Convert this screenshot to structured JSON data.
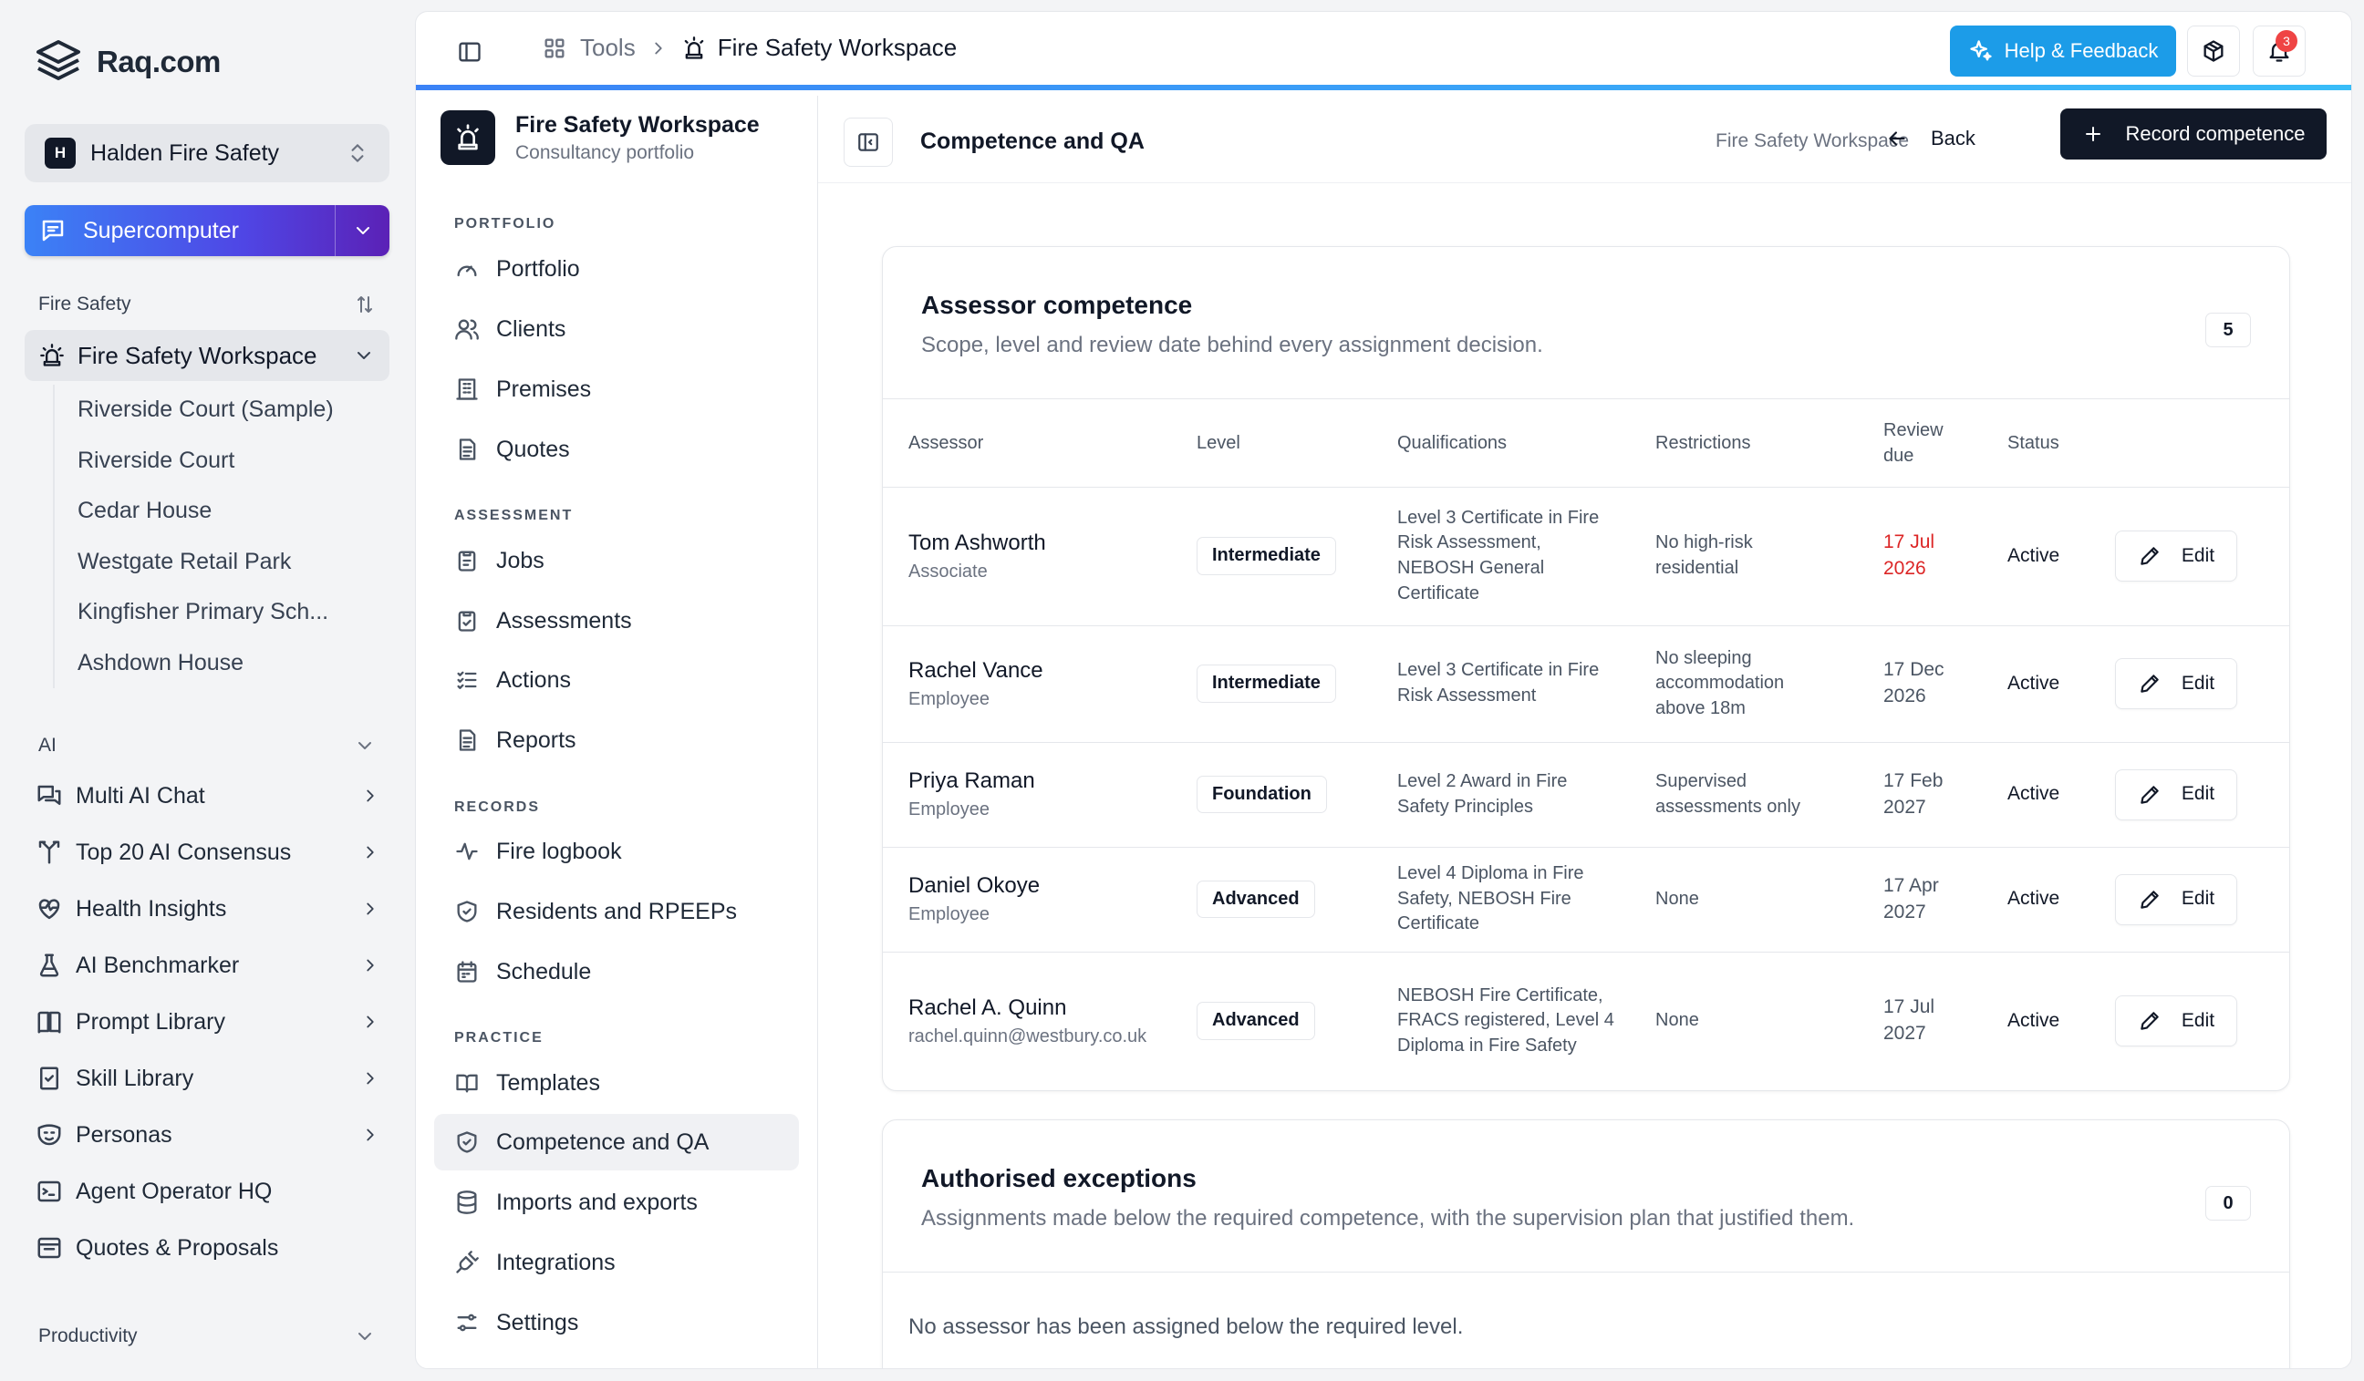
{
  "brand": {
    "name": "Raq.com"
  },
  "org": {
    "badge": "H",
    "name": "Halden Fire Safety"
  },
  "supercomputer": {
    "label": "Supercomputer"
  },
  "sidebar": {
    "fire_section": "Fire Safety",
    "workspace": "Fire Safety Workspace",
    "workspace_items": [
      "Riverside Court (Sample)",
      "Riverside Court",
      "Cedar House",
      "Westgate Retail Park",
      "Kingfisher Primary Sch...",
      "Ashdown House"
    ],
    "ai_section": "AI",
    "ai_items": [
      {
        "label": "Multi AI Chat",
        "icon": "chat-icon",
        "chevron": true
      },
      {
        "label": "Top 20 AI Consensus",
        "icon": "merge-icon",
        "chevron": true
      },
      {
        "label": "Health Insights",
        "icon": "heart-pulse-icon",
        "chevron": true
      },
      {
        "label": "AI Benchmarker",
        "icon": "flask-icon",
        "chevron": true
      },
      {
        "label": "Prompt Library",
        "icon": "book-icon",
        "chevron": true
      },
      {
        "label": "Skill Library",
        "icon": "skill-book-icon",
        "chevron": true
      },
      {
        "label": "Personas",
        "icon": "mask-icon",
        "chevron": true
      },
      {
        "label": "Agent Operator HQ",
        "icon": "terminal-icon",
        "chevron": false
      },
      {
        "label": "Quotes & Proposals",
        "icon": "inbox-icon",
        "chevron": false
      }
    ],
    "productivity_section": "Productivity"
  },
  "topbar": {
    "breadcrumb_tools": "Tools",
    "breadcrumb_current": "Fire Safety Workspace",
    "help_label": "Help & Feedback",
    "notification_count": "3"
  },
  "wsnav": {
    "title": "Fire Safety Workspace",
    "subtitle": "Consultancy portfolio",
    "groups": {
      "portfolio": "PORTFOLIO",
      "assessment": "ASSESSMENT",
      "records": "RECORDS",
      "practice": "PRACTICE"
    },
    "items": {
      "portfolio": "Portfolio",
      "clients": "Clients",
      "premises": "Premises",
      "quotes": "Quotes",
      "jobs": "Jobs",
      "assessments": "Assessments",
      "actions": "Actions",
      "reports": "Reports",
      "fire_logbook": "Fire logbook",
      "residents": "Residents and RPEEPs",
      "schedule": "Schedule",
      "templates": "Templates",
      "competence": "Competence and QA",
      "imports": "Imports and exports",
      "integrations": "Integrations",
      "settings": "Settings"
    }
  },
  "content": {
    "title": "Competence and QA",
    "workspace_link": "Fire Safety Workspace",
    "back_label": "Back",
    "record_label": "Record competence"
  },
  "assessor_card": {
    "title": "Assessor competence",
    "subtitle": "Scope, level and review date behind every assignment decision.",
    "count": "5",
    "columns": {
      "assessor": "Assessor",
      "level": "Level",
      "qualifications": "Qualifications",
      "restrictions": "Restrictions",
      "review_due": "Review due",
      "status": "Status"
    },
    "edit_label": "Edit",
    "rows": [
      {
        "name": "Tom Ashworth",
        "role": "Associate",
        "level": "Intermediate",
        "qualifications": "Level 3 Certificate in Fire Risk Assessment, NEBOSH General Certificate",
        "restrictions": "No high-risk residential",
        "review_due": "17 Jul 2026",
        "overdue": true,
        "status": "Active"
      },
      {
        "name": "Rachel Vance",
        "role": "Employee",
        "level": "Intermediate",
        "qualifications": "Level 3 Certificate in Fire Risk Assessment",
        "restrictions": "No sleeping accommodation above 18m",
        "review_due": "17 Dec 2026",
        "overdue": false,
        "status": "Active"
      },
      {
        "name": "Priya Raman",
        "role": "Employee",
        "level": "Foundation",
        "qualifications": "Level 2 Award in Fire Safety Principles",
        "restrictions": "Supervised assessments only",
        "review_due": "17 Feb 2027",
        "overdue": false,
        "status": "Active"
      },
      {
        "name": "Daniel Okoye",
        "role": "Employee",
        "level": "Advanced",
        "qualifications": "Level 4 Diploma in Fire Safety, NEBOSH Fire Certificate",
        "restrictions": "None",
        "review_due": "17 Apr 2027",
        "overdue": false,
        "status": "Active"
      },
      {
        "name": "Rachel A. Quinn",
        "role": "rachel.quinn@westbury.co.uk",
        "level": "Advanced",
        "qualifications": "NEBOSH Fire Certificate, FRACS registered, Level 4 Diploma in Fire Safety",
        "restrictions": "None",
        "review_due": "17 Jul 2027",
        "overdue": false,
        "status": "Active"
      }
    ]
  },
  "exceptions_card": {
    "title": "Authorised exceptions",
    "subtitle": "Assignments made below the required competence, with the supervision plan that justified them.",
    "count": "0",
    "empty": "No assessor has been assigned below the required level."
  },
  "colors": {
    "accent_blue": "#1c9ce8",
    "primary": "#111827",
    "overdue": "#dc2626"
  }
}
